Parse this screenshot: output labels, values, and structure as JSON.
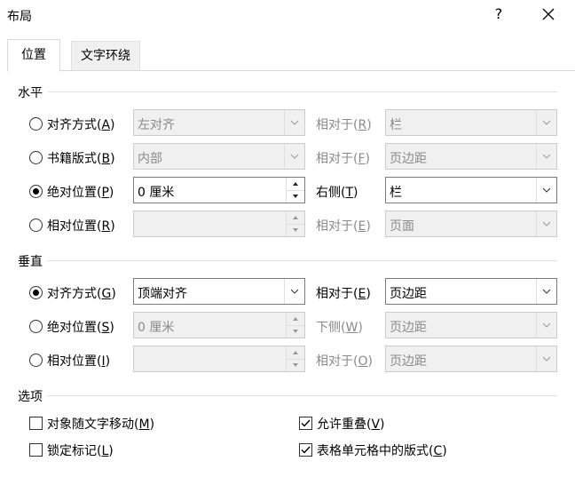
{
  "window": {
    "title": "布局",
    "help_glyph": "?",
    "close_glyph": "✕"
  },
  "tabs": [
    {
      "label": "位置",
      "active": true
    },
    {
      "label": "文字环绕",
      "active": false
    }
  ],
  "horizontal": {
    "section_label": "水平",
    "rows": [
      {
        "radio_text": "对齐方式",
        "key": "A",
        "field": "左对齐",
        "rel_text": "相对于",
        "rel_key": "R",
        "rel_value": "栏"
      },
      {
        "radio_text": "书籍版式",
        "key": "B",
        "field": "内部",
        "rel_text": "相对于",
        "rel_key": "F",
        "rel_value": "页边距"
      },
      {
        "radio_text": "绝对位置",
        "key": "P",
        "field": "0 厘米",
        "rel_text": "右侧",
        "rel_key": "T",
        "rel_value": "栏"
      },
      {
        "radio_text": "相对位置",
        "key": "R",
        "field": "",
        "rel_text": "相对于",
        "rel_key": "E",
        "rel_value": "页面"
      }
    ]
  },
  "vertical": {
    "section_label": "垂直",
    "rows": [
      {
        "radio_text": "对齐方式",
        "key": "G",
        "field": "顶端对齐",
        "rel_text": "相对于",
        "rel_key": "E",
        "rel_value": "页边距"
      },
      {
        "radio_text": "绝对位置",
        "key": "S",
        "field": "0 厘米",
        "rel_text": "下侧",
        "rel_key": "W",
        "rel_value": "页边距"
      },
      {
        "radio_text": "相对位置",
        "key": "I",
        "field": "",
        "rel_text": "相对于",
        "rel_key": "O",
        "rel_value": "页边距"
      }
    ]
  },
  "options": {
    "section_label": "选项",
    "move_with_text": {
      "text": "对象随文字移动",
      "key": "M",
      "checked": false
    },
    "lock_anchor": {
      "text": "锁定标记",
      "key": "L",
      "checked": false
    },
    "allow_overlap": {
      "text": "允许重叠",
      "key": "V",
      "checked": true
    },
    "layout_in_cell": {
      "text": "表格单元格中的版式",
      "key": "C",
      "checked": true
    }
  },
  "paren_open": "(",
  "paren_close": ")"
}
